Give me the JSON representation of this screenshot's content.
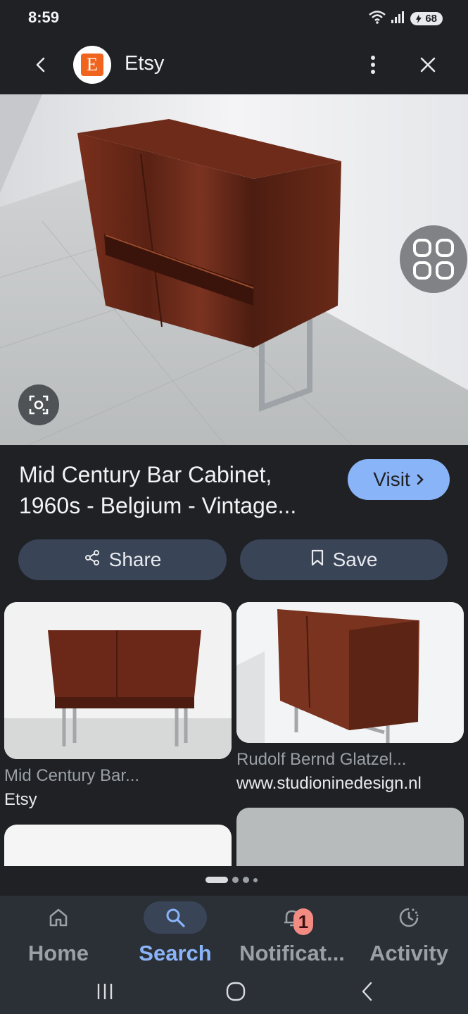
{
  "status_bar": {
    "time": "8:59",
    "battery": "68",
    "icons": [
      "wifi-icon",
      "signal-icon",
      "battery-icon"
    ]
  },
  "app_bar": {
    "site_logo_letter": "E",
    "site_name": "Etsy",
    "icons": [
      "back-arrow-icon",
      "more-vert-icon",
      "close-icon"
    ]
  },
  "hero": {
    "icons": [
      "lens-icon",
      "grid-icon"
    ]
  },
  "result": {
    "title": "Mid Century Bar Cabinet, 1960s - Belgium - Vintage...",
    "visit_label": "Visit",
    "share_label": "Share",
    "save_label": "Save"
  },
  "related": [
    {
      "title": "Mid Century Bar...",
      "source": "Etsy"
    },
    {
      "title": "Rudolf Bernd Glatzel...",
      "source": "www.studioninedesign.nl"
    }
  ],
  "bottom_nav": {
    "items": [
      {
        "label": "Home",
        "icon": "home-icon",
        "active": false
      },
      {
        "label": "Search",
        "icon": "search-icon",
        "active": true
      },
      {
        "label": "Notificat...",
        "icon": "bell-icon",
        "active": false,
        "badge": "1"
      },
      {
        "label": "Activity",
        "icon": "activity-icon",
        "active": false
      }
    ]
  },
  "colors": {
    "background": "#1f2125",
    "accent": "#8ab4f8",
    "pill": "#394457",
    "etsy_orange": "#f1641e",
    "badge": "#f28b82"
  }
}
